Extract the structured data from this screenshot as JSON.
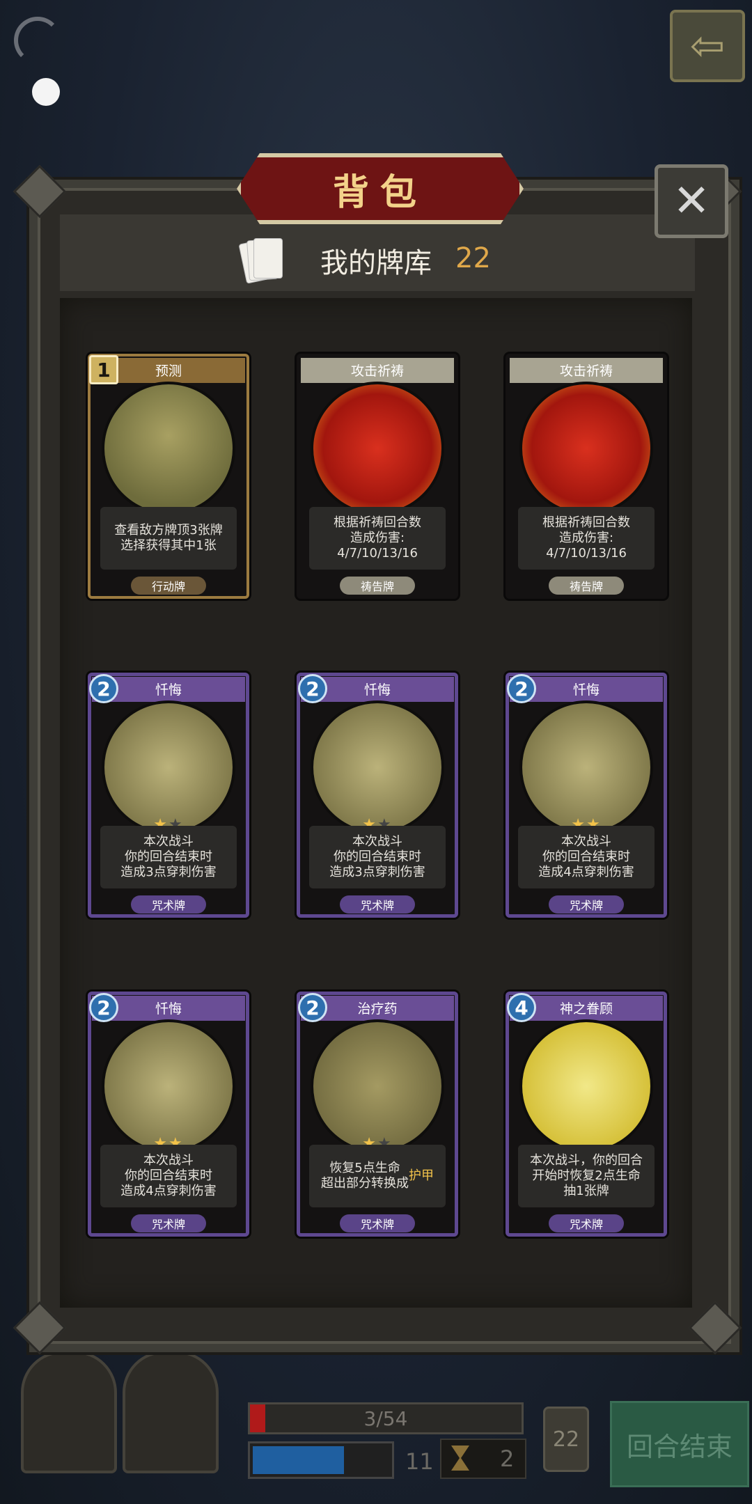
{
  "title": "背包",
  "deck": {
    "label": "我的牌库",
    "count": "22"
  },
  "cards": [
    {
      "cost": "1",
      "cost_style": "square",
      "name": "预测",
      "desc": [
        "查看敌方牌顶3张牌",
        "选择获得其中1张"
      ],
      "type": "行动牌",
      "theme": "gold",
      "art": "witch",
      "stars": 0
    },
    {
      "cost": "",
      "name": "攻击祈祷",
      "desc": [
        "根据祈祷回合数",
        "造成伤害:",
        "4/7/10/13/16"
      ],
      "type": "祷告牌",
      "theme": "tan",
      "art": "fire",
      "stars": 0
    },
    {
      "cost": "",
      "name": "攻击祈祷",
      "desc": [
        "根据祈祷回合数",
        "造成伤害:",
        "4/7/10/13/16"
      ],
      "type": "祷告牌",
      "theme": "tan",
      "art": "fire",
      "stars": 0
    },
    {
      "cost": "2",
      "name": "忏悔",
      "desc": [
        "本次战斗",
        "你的回合结束时",
        "造成3点穿刺伤害"
      ],
      "type": "咒术牌",
      "theme": "purple",
      "art": "cross",
      "stars": 1
    },
    {
      "cost": "2",
      "name": "忏悔",
      "desc": [
        "本次战斗",
        "你的回合结束时",
        "造成3点穿刺伤害"
      ],
      "type": "咒术牌",
      "theme": "purple",
      "art": "cross",
      "stars": 1
    },
    {
      "cost": "2",
      "name": "忏悔",
      "desc": [
        "本次战斗",
        "你的回合结束时",
        "造成4点穿刺伤害"
      ],
      "type": "咒术牌",
      "theme": "purple",
      "art": "cross",
      "stars": 2
    },
    {
      "cost": "2",
      "name": "忏悔",
      "desc": [
        "本次战斗",
        "你的回合结束时",
        "造成4点穿刺伤害"
      ],
      "type": "咒术牌",
      "theme": "purple",
      "art": "cross",
      "stars": 2
    },
    {
      "cost": "2",
      "name": "治疗药",
      "desc": [
        "恢复5点生命",
        "超出部分转换成护甲"
      ],
      "type": "咒术牌",
      "theme": "purple",
      "art": "potion",
      "stars": 1
    },
    {
      "cost": "4",
      "name": "神之眷顾",
      "desc": [
        "本次战斗，你的回合",
        "开始时恢复2点生命",
        "抽1张牌"
      ],
      "type": "咒术牌",
      "theme": "purple",
      "art": "angel",
      "stars": 0
    }
  ],
  "hud": {
    "hp_text": "3/54",
    "hp_fraction": 0.056,
    "mana": "11",
    "mana_fraction": 0.68,
    "turn": "2",
    "deck_count": "22",
    "end_turn_label": "回合结束"
  }
}
